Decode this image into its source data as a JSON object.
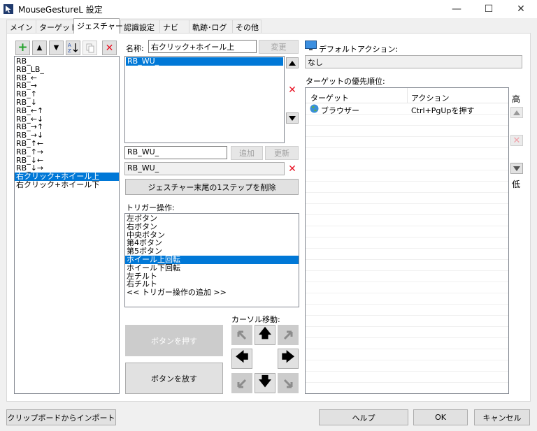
{
  "window": {
    "title": "MouseGestureL 設定",
    "minimize": "—",
    "maximize": "☐",
    "close": "✕"
  },
  "tabs": [
    {
      "label": "メイン"
    },
    {
      "label": "ターゲット"
    },
    {
      "label": "ジェスチャー"
    },
    {
      "label": "認識設定"
    },
    {
      "label": "ナビ"
    },
    {
      "label": "軌跡･ログ"
    },
    {
      "label": "その他"
    }
  ],
  "toolbar": {
    "add": "+",
    "up": "▲",
    "down": "▼",
    "delete": "✕"
  },
  "gesture_list": [
    "RB_",
    "RB_LB_",
    "RB_←",
    "RB_→",
    "RB_↑",
    "RB_↓",
    "RB_←↑",
    "RB_←↓",
    "RB_→↑",
    "RB_→↓",
    "RB_↑←",
    "RB_↑→",
    "RB_↓←",
    "RB_↓→",
    "右クリック+ホイール上",
    "右クリック+ホイール下"
  ],
  "gesture_list_selected": "右クリック+ホイール上",
  "name_field": {
    "label": "名称:",
    "value": "右クリック+ホイール上",
    "change_button": "変更"
  },
  "pattern_list": [
    "RB_WU_"
  ],
  "pattern_list_selected": "RB_WU_",
  "pattern_input": {
    "value": "RB_WU_",
    "add_button": "追加",
    "update_button": "更新"
  },
  "pattern_readonly": "RB_WU_",
  "delete_last_step_button": "ジェスチャー末尾の1ステップを削除",
  "trigger": {
    "label": "トリガー操作:",
    "items": [
      "左ボタン",
      "右ボタン",
      "中央ボタン",
      "第4ボタン",
      "第5ボタン",
      "ホイール上回転",
      "ホイール下回転",
      "左チルト",
      "右チルト",
      "<< トリガー操作の追加 >>"
    ],
    "selected": "ホイール上回転"
  },
  "cursor_move_label": "カーソル移動:",
  "press_button": "ボタンを押す",
  "release_button": "ボタンを放す",
  "arrows": {
    "up": "🡅",
    "down": "🡇",
    "left": "🡄",
    "right": "🡆"
  },
  "default_action": {
    "label": "デフォルトアクション:",
    "value": "なし"
  },
  "priority": {
    "label": "ターゲットの優先順位:",
    "col_target": "ターゲット",
    "col_action": "アクション",
    "rows": [
      {
        "target": "ブラウザー",
        "action": "Ctrl+PgUpを押す"
      }
    ],
    "high": "高",
    "low": "低"
  },
  "footer": {
    "import": "クリップボードからインポート",
    "help": "ヘルプ",
    "ok": "OK",
    "cancel": "キャンセル"
  },
  "colors": {
    "selection": "#0078d7",
    "delete_red": "#e81123",
    "add_green": "#22a02a"
  }
}
